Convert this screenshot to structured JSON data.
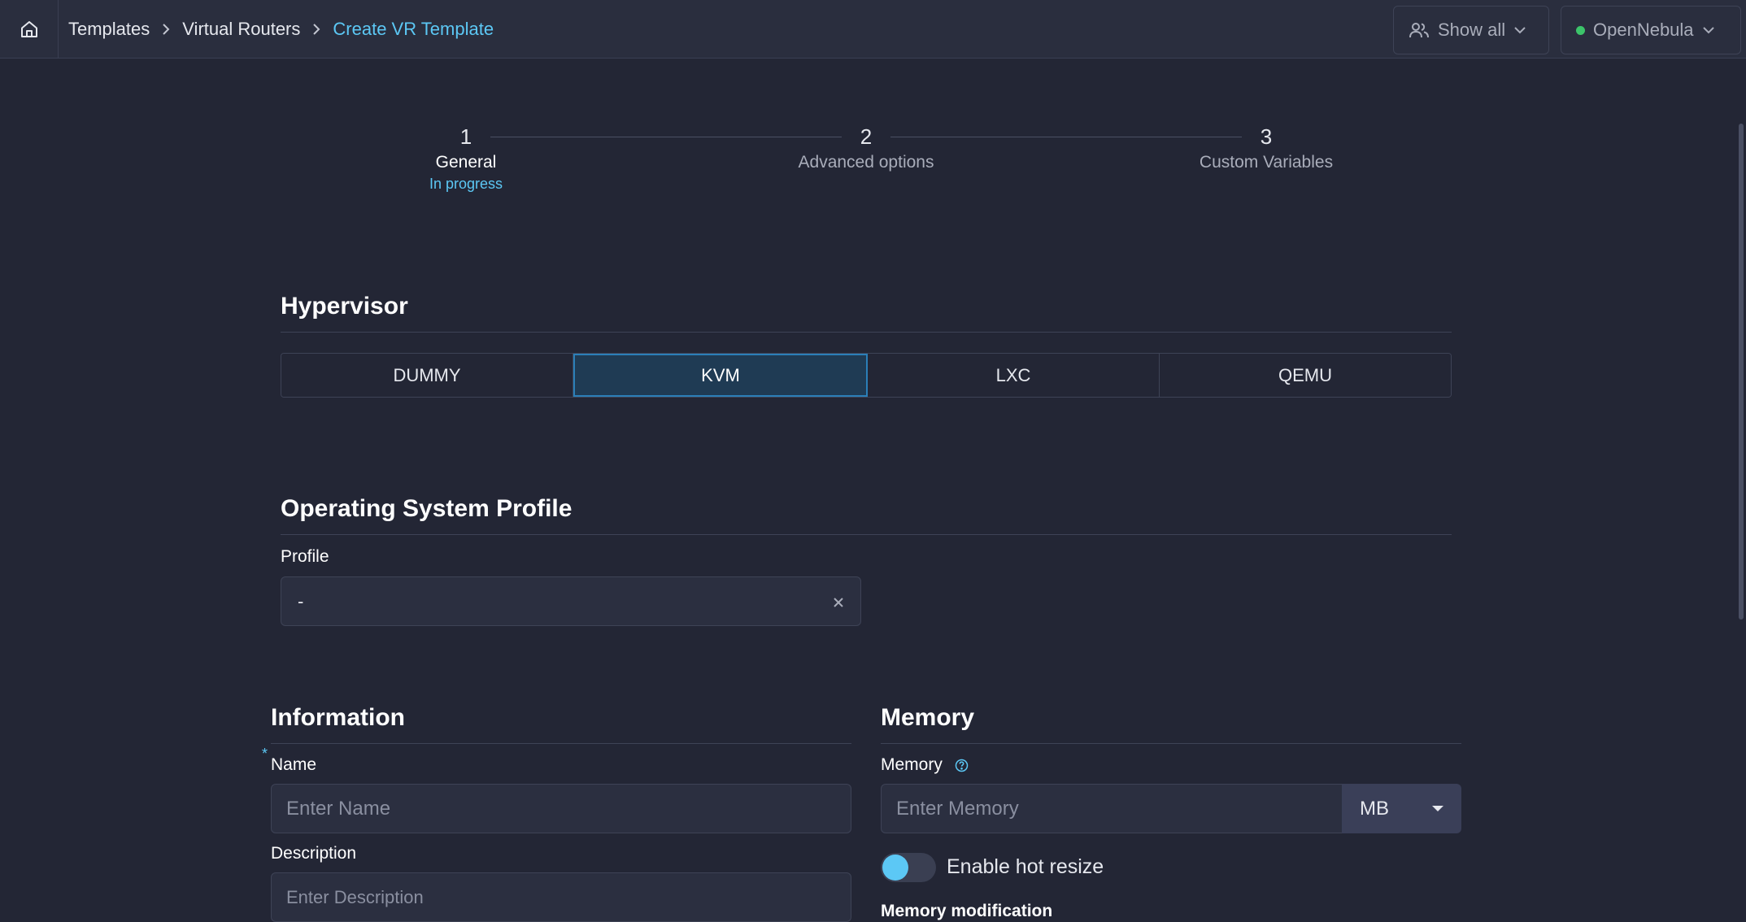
{
  "breadcrumb": {
    "items": [
      "Templates",
      "Virtual Routers",
      "Create VR Template"
    ]
  },
  "topbar": {
    "group_filter": "Show all",
    "zone": "OpenNebula"
  },
  "stepper": {
    "steps": [
      {
        "number": "1",
        "label": "General",
        "status": "In progress"
      },
      {
        "number": "2",
        "label": "Advanced options"
      },
      {
        "number": "3",
        "label": "Custom Variables"
      }
    ]
  },
  "hypervisor": {
    "title": "Hypervisor",
    "options": [
      "DUMMY",
      "KVM",
      "LXC",
      "QEMU"
    ],
    "selected": "KVM"
  },
  "os_profile": {
    "title": "Operating System Profile",
    "profile_label": "Profile",
    "profile_value": "-"
  },
  "information": {
    "title": "Information",
    "name_label": "Name",
    "name_placeholder": "Enter Name",
    "description_label": "Description",
    "description_placeholder": "Enter Description",
    "required_mark": "*"
  },
  "memory": {
    "title": "Memory",
    "memory_label": "Memory",
    "memory_placeholder": "Enter Memory",
    "unit": "MB",
    "hot_resize_label": "Enable hot resize",
    "hot_resize_enabled": false,
    "modification_label": "Memory modification"
  },
  "colors": {
    "accent": "#5cc8f5",
    "background": "#232635",
    "status_online": "#3cc46a"
  }
}
